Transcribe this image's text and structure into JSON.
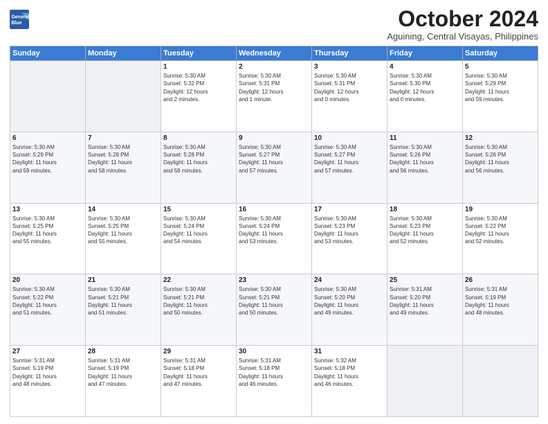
{
  "header": {
    "logo_line1": "General",
    "logo_line2": "Blue",
    "month": "October 2024",
    "location": "Aguining, Central Visayas, Philippines"
  },
  "weekdays": [
    "Sunday",
    "Monday",
    "Tuesday",
    "Wednesday",
    "Thursday",
    "Friday",
    "Saturday"
  ],
  "rows": [
    [
      {
        "day": "",
        "info": ""
      },
      {
        "day": "",
        "info": ""
      },
      {
        "day": "1",
        "info": "Sunrise: 5:30 AM\nSunset: 5:32 PM\nDaylight: 12 hours\nand 2 minutes."
      },
      {
        "day": "2",
        "info": "Sunrise: 5:30 AM\nSunset: 5:31 PM\nDaylight: 12 hours\nand 1 minute."
      },
      {
        "day": "3",
        "info": "Sunrise: 5:30 AM\nSunset: 5:31 PM\nDaylight: 12 hours\nand 0 minutes."
      },
      {
        "day": "4",
        "info": "Sunrise: 5:30 AM\nSunset: 5:30 PM\nDaylight: 12 hours\nand 0 minutes."
      },
      {
        "day": "5",
        "info": "Sunrise: 5:30 AM\nSunset: 5:29 PM\nDaylight: 11 hours\nand 59 minutes."
      }
    ],
    [
      {
        "day": "6",
        "info": "Sunrise: 5:30 AM\nSunset: 5:29 PM\nDaylight: 11 hours\nand 59 minutes."
      },
      {
        "day": "7",
        "info": "Sunrise: 5:30 AM\nSunset: 5:28 PM\nDaylight: 11 hours\nand 58 minutes."
      },
      {
        "day": "8",
        "info": "Sunrise: 5:30 AM\nSunset: 5:28 PM\nDaylight: 11 hours\nand 58 minutes."
      },
      {
        "day": "9",
        "info": "Sunrise: 5:30 AM\nSunset: 5:27 PM\nDaylight: 11 hours\nand 57 minutes."
      },
      {
        "day": "10",
        "info": "Sunrise: 5:30 AM\nSunset: 5:27 PM\nDaylight: 11 hours\nand 57 minutes."
      },
      {
        "day": "11",
        "info": "Sunrise: 5:30 AM\nSunset: 5:26 PM\nDaylight: 11 hours\nand 56 minutes."
      },
      {
        "day": "12",
        "info": "Sunrise: 5:30 AM\nSunset: 5:26 PM\nDaylight: 11 hours\nand 56 minutes."
      }
    ],
    [
      {
        "day": "13",
        "info": "Sunrise: 5:30 AM\nSunset: 5:25 PM\nDaylight: 11 hours\nand 55 minutes."
      },
      {
        "day": "14",
        "info": "Sunrise: 5:30 AM\nSunset: 5:25 PM\nDaylight: 11 hours\nand 55 minutes."
      },
      {
        "day": "15",
        "info": "Sunrise: 5:30 AM\nSunset: 5:24 PM\nDaylight: 11 hours\nand 54 minutes."
      },
      {
        "day": "16",
        "info": "Sunrise: 5:30 AM\nSunset: 5:24 PM\nDaylight: 11 hours\nand 53 minutes."
      },
      {
        "day": "17",
        "info": "Sunrise: 5:30 AM\nSunset: 5:23 PM\nDaylight: 11 hours\nand 53 minutes."
      },
      {
        "day": "18",
        "info": "Sunrise: 5:30 AM\nSunset: 5:23 PM\nDaylight: 11 hours\nand 52 minutes."
      },
      {
        "day": "19",
        "info": "Sunrise: 5:30 AM\nSunset: 5:22 PM\nDaylight: 11 hours\nand 52 minutes."
      }
    ],
    [
      {
        "day": "20",
        "info": "Sunrise: 5:30 AM\nSunset: 5:22 PM\nDaylight: 11 hours\nand 51 minutes."
      },
      {
        "day": "21",
        "info": "Sunrise: 5:30 AM\nSunset: 5:21 PM\nDaylight: 11 hours\nand 51 minutes."
      },
      {
        "day": "22",
        "info": "Sunrise: 5:30 AM\nSunset: 5:21 PM\nDaylight: 11 hours\nand 50 minutes."
      },
      {
        "day": "23",
        "info": "Sunrise: 5:30 AM\nSunset: 5:21 PM\nDaylight: 11 hours\nand 50 minutes."
      },
      {
        "day": "24",
        "info": "Sunrise: 5:30 AM\nSunset: 5:20 PM\nDaylight: 11 hours\nand 49 minutes."
      },
      {
        "day": "25",
        "info": "Sunrise: 5:31 AM\nSunset: 5:20 PM\nDaylight: 11 hours\nand 49 minutes."
      },
      {
        "day": "26",
        "info": "Sunrise: 5:31 AM\nSunset: 5:19 PM\nDaylight: 11 hours\nand 48 minutes."
      }
    ],
    [
      {
        "day": "27",
        "info": "Sunrise: 5:31 AM\nSunset: 5:19 PM\nDaylight: 11 hours\nand 48 minutes."
      },
      {
        "day": "28",
        "info": "Sunrise: 5:31 AM\nSunset: 5:19 PM\nDaylight: 11 hours\nand 47 minutes."
      },
      {
        "day": "29",
        "info": "Sunrise: 5:31 AM\nSunset: 5:18 PM\nDaylight: 11 hours\nand 47 minutes."
      },
      {
        "day": "30",
        "info": "Sunrise: 5:31 AM\nSunset: 5:18 PM\nDaylight: 11 hours\nand 46 minutes."
      },
      {
        "day": "31",
        "info": "Sunrise: 5:32 AM\nSunset: 5:18 PM\nDaylight: 11 hours\nand 46 minutes."
      },
      {
        "day": "",
        "info": ""
      },
      {
        "day": "",
        "info": ""
      }
    ]
  ]
}
